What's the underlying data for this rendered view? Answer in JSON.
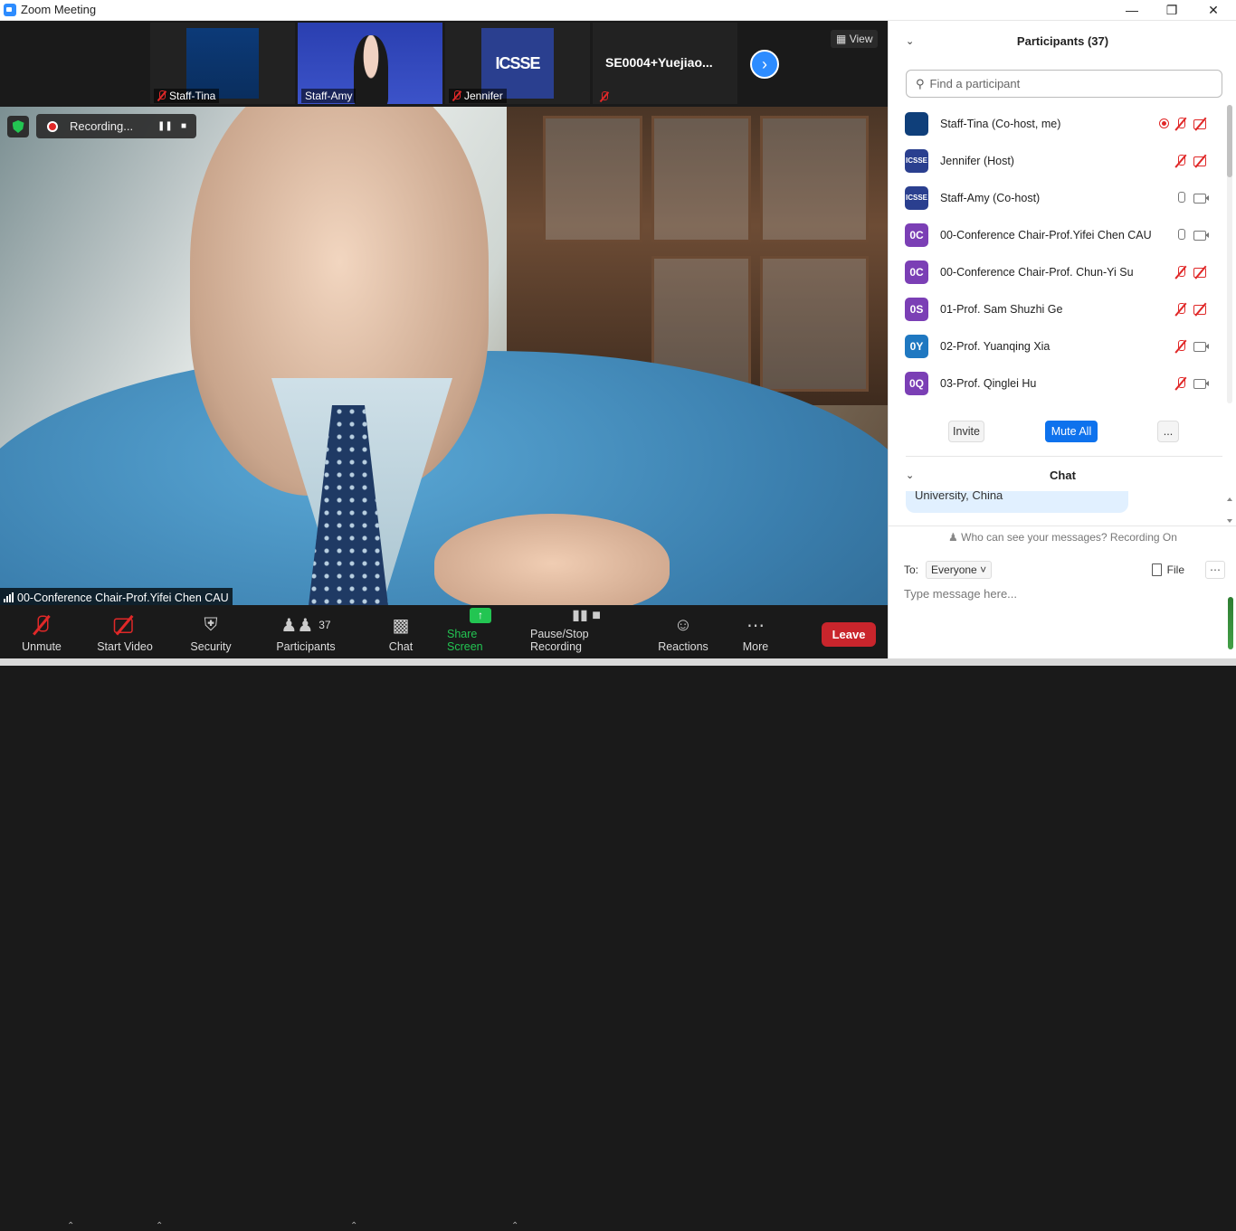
{
  "window": {
    "title": "Zoom Meeting"
  },
  "gallery": {
    "thumbs": [
      {
        "name": "Staff-Tina"
      },
      {
        "name": "Staff-Amy"
      },
      {
        "name": "Jennifer",
        "logo": "ICSSE"
      },
      {
        "name": "",
        "label": "SE0004+Yuejiao..."
      }
    ],
    "view_label": "View"
  },
  "recording": {
    "label": "Recording..."
  },
  "speaker": {
    "name": "00-Conference Chair-Prof.Yifei  Chen CAU"
  },
  "toolbar": {
    "unmute": "Unmute",
    "start_video": "Start Video",
    "security": "Security",
    "participants": "Participants",
    "participants_count": "37",
    "chat": "Chat",
    "share_screen": "Share Screen",
    "recording": "Pause/Stop Recording",
    "reactions": "Reactions",
    "more": "More",
    "leave": "Leave"
  },
  "participants_panel": {
    "title": "Participants (37)",
    "search_placeholder": "Find a participant",
    "list": [
      {
        "initials": "",
        "name": "Staff-Tina (Co-host, me)",
        "color": "#0f3f7a",
        "mic": "off",
        "cam": "off",
        "recording": true
      },
      {
        "initials": "ICSSE",
        "name": "Jennifer (Host)",
        "color": "#2a3f8f",
        "mic": "off",
        "cam": "off",
        "recording": false
      },
      {
        "initials": "ICSSE",
        "name": "Staff-Amy (Co-host)",
        "color": "#2a3f8f",
        "mic": "on",
        "cam": "on",
        "recording": false
      },
      {
        "initials": "0C",
        "name": "00-Conference Chair-Prof.Yifei  Chen CAU",
        "color": "#7b3fb5",
        "mic": "on",
        "cam": "on",
        "recording": false
      },
      {
        "initials": "0C",
        "name": "00-Conference Chair-Prof. Chun-Yi Su",
        "color": "#7b3fb5",
        "mic": "off",
        "cam": "off",
        "recording": false
      },
      {
        "initials": "0S",
        "name": "01-Prof. Sam Shuzhi Ge",
        "color": "#7b3fb5",
        "mic": "off",
        "cam": "off",
        "recording": false
      },
      {
        "initials": "0Y",
        "name": "02-Prof. Yuanqing Xia",
        "color": "#1f78c1",
        "mic": "off",
        "cam": "on",
        "recording": false
      },
      {
        "initials": "0Q",
        "name": "03-Prof. Qinglei Hu",
        "color": "#7b3fb5",
        "mic": "off",
        "cam": "on",
        "recording": false
      }
    ],
    "invite": "Invite",
    "mute_all": "Mute All",
    "more": "..."
  },
  "chat_panel": {
    "title": "Chat",
    "last_message_fragment": "University, China",
    "visibility_note": "Who can see your messages? Recording On",
    "to_label": "To:",
    "recipient": "Everyone",
    "file_label": "File",
    "input_placeholder": "Type message here..."
  },
  "colors": {
    "accent": "#0e72ed",
    "leave": "#c9252c",
    "share": "#23c552",
    "mic_off": "#e02828"
  }
}
